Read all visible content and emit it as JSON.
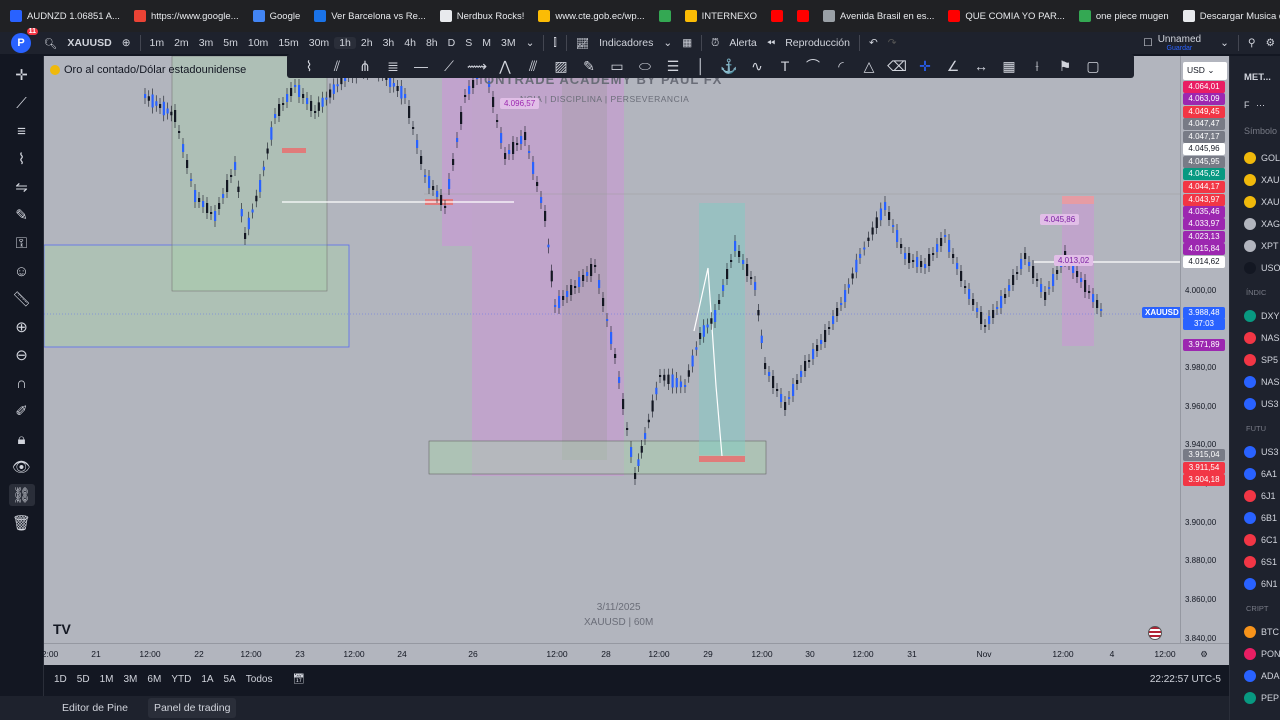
{
  "bookmarks": [
    {
      "label": "AUDNZD 1.06851 A...",
      "color": "#2962ff"
    },
    {
      "label": "https://www.google...",
      "color": "#ea4335"
    },
    {
      "label": "Google",
      "color": "#4285f4"
    },
    {
      "label": "Ver Barcelona vs Re...",
      "color": "#1a73e8"
    },
    {
      "label": "Nerdbux Rocks!",
      "color": "#e8eaed"
    },
    {
      "label": "www.cte.gob.ec/wp...",
      "color": "#fbbc05"
    },
    {
      "label": "",
      "color": "#34a853"
    },
    {
      "label": "INTERNEXO",
      "color": "#fbbc05"
    },
    {
      "label": "",
      "color": "#ff0000"
    },
    {
      "label": "",
      "color": "#ff0000"
    },
    {
      "label": "Avenida Brasil en es...",
      "color": "#9aa0a6"
    },
    {
      "label": "QUE COMIA YO PAR...",
      "color": "#ff0000"
    },
    {
      "label": "one piece mugen",
      "color": "#34a853"
    },
    {
      "label": "Descargar Musica d...",
      "color": "#e8eaed"
    }
  ],
  "topbar": {
    "avatar_letter": "P",
    "notif_count": "11",
    "symbol": "XAUUSD",
    "timeframes": [
      "1m",
      "2m",
      "3m",
      "5m",
      "10m",
      "15m",
      "30m",
      "1h",
      "2h",
      "3h",
      "4h",
      "8h",
      "D",
      "S",
      "M",
      "3M"
    ],
    "active_timeframe": "1h",
    "indicators": "Indicadores",
    "alert": "Alerta",
    "replay": "Reproducción",
    "layout_name": "Unnamed",
    "layout_status": "Guardar"
  },
  "chart": {
    "title": "Oro al contado/Dólar estadounidense",
    "academy": "ONTRADE ACADEMY BY PAUL FX",
    "academy_sub": "NCIA  |  DISCIPLINA  |  PERSEVERANCIA",
    "watermark_date": "3/11/2025",
    "watermark_symbol": "XAUUSD | 60M",
    "annotations": [
      "4.096,57",
      "4.045,86",
      "4.013,02"
    ],
    "currency": "USD",
    "symbol_tag": "XAUUSD"
  },
  "price_axis": {
    "ticks": [
      "4.000,00",
      "3.980,00",
      "3.960,00",
      "3.940,00",
      "3.920,00",
      "3.900,00",
      "3.880,00",
      "3.860,00",
      "3.840,00",
      "3.820,00"
    ],
    "labels": [
      {
        "text": "4.064,01",
        "color": "#e91e63"
      },
      {
        "text": "4.063,09",
        "color": "#9c27b0"
      },
      {
        "text": "4.049,45",
        "color": "#f23645"
      },
      {
        "text": "4.047,47",
        "color": "#787b86"
      },
      {
        "text": "4.047,17",
        "color": "#787b86"
      },
      {
        "text": "4.045,96",
        "color": "#ffffff"
      },
      {
        "text": "4.045,95",
        "color": "#787b86"
      },
      {
        "text": "4.045,62",
        "color": "#089981"
      },
      {
        "text": "4.044,17",
        "color": "#f23645"
      },
      {
        "text": "4.043,97",
        "color": "#f23645"
      },
      {
        "text": "4.035,46",
        "color": "#9c27b0"
      },
      {
        "text": "4.033,97",
        "color": "#9c27b0"
      },
      {
        "text": "4.023,13",
        "color": "#9c27b0"
      },
      {
        "text": "4.015,84",
        "color": "#9c27b0"
      },
      {
        "text": "4.014,62",
        "color": "#ffffff"
      },
      {
        "text": "3.988,48",
        "color": "#2962ff"
      },
      {
        "text": "37:03",
        "color": "#2962ff"
      },
      {
        "text": "3.971,89",
        "color": "#9c27b0"
      },
      {
        "text": "3.915,04",
        "color": "#787b86"
      },
      {
        "text": "3.911,54",
        "color": "#f23645"
      },
      {
        "text": "3.904,18",
        "color": "#f23645"
      }
    ]
  },
  "time_axis": {
    "labels": [
      "2:00",
      "21",
      "12:00",
      "22",
      "12:00",
      "23",
      "12:00",
      "24",
      "26",
      "12:00",
      "28",
      "12:00",
      "29",
      "12:00",
      "30",
      "12:00",
      "31",
      "Nov",
      "12:00",
      "4",
      "12:00"
    ]
  },
  "bottom_bar": {
    "ranges": [
      "1D",
      "5D",
      "1M",
      "3M",
      "6M",
      "YTD",
      "1A",
      "5A",
      "Todos"
    ],
    "clock": "22:22:57 UTC-5"
  },
  "panel_tabs": [
    "Editor de Pine",
    "Panel de trading"
  ],
  "right_panel": {
    "header": "MET...",
    "symbols_label": "Símbolo",
    "watchlist": [
      {
        "name": "GOL",
        "color": "#f0b90b"
      },
      {
        "name": "XAU",
        "color": "#f0b90b"
      },
      {
        "name": "XAU",
        "color": "#f0b90b"
      },
      {
        "name": "XAG",
        "color": "#b2b5be"
      },
      {
        "name": "XPT",
        "color": "#b2b5be"
      },
      {
        "name": "USO",
        "color": "#131722"
      }
    ],
    "indices_label": "ÍNDIC",
    "indices": [
      {
        "name": "DXY",
        "color": "#089981"
      },
      {
        "name": "NAS",
        "color": "#f23645"
      },
      {
        "name": "SP5",
        "color": "#f23645"
      },
      {
        "name": "NAS",
        "color": "#2962ff"
      },
      {
        "name": "US3",
        "color": "#2962ff"
      }
    ],
    "futures_label": "FUTU",
    "futures": [
      {
        "name": "US3",
        "color": "#2962ff"
      },
      {
        "name": "6A1",
        "color": "#2962ff"
      },
      {
        "name": "6J1",
        "color": "#f23645"
      },
      {
        "name": "6B1",
        "color": "#2962ff"
      },
      {
        "name": "6C1",
        "color": "#f23645"
      },
      {
        "name": "6S1",
        "color": "#f23645"
      },
      {
        "name": "6N1",
        "color": "#2962ff"
      }
    ],
    "crypto_label": "CRIPT",
    "crypto": [
      {
        "name": "BTC",
        "color": "#f7931a"
      },
      {
        "name": "PON",
        "color": "#e91e63"
      },
      {
        "name": "ADA",
        "color": "#2962ff"
      },
      {
        "name": "PEP",
        "color": "#089981"
      }
    ]
  }
}
